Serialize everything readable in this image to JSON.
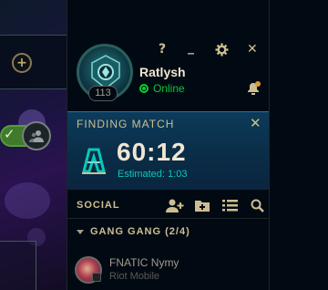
{
  "window_controls": {
    "help": "?",
    "minimize": "_",
    "settings_icon": "gear-icon",
    "close": "✕"
  },
  "profile": {
    "name": "Ratlysh",
    "status": "Online",
    "level": "113",
    "status_color": "#0acb32"
  },
  "finding_match": {
    "title": "FINDING MATCH",
    "timer": "60:12",
    "estimated": "Estimated: 1:03",
    "close": "✕"
  },
  "social": {
    "title": "SOCIAL",
    "icons": [
      "add-friend-icon",
      "add-folder-icon",
      "list-icon",
      "search-icon"
    ]
  },
  "groups": [
    {
      "label": "GANG GANG (2/4)",
      "friends": [
        {
          "name": "FNATIC Nymy",
          "status": "Riot Mobile"
        }
      ]
    }
  ],
  "left_area": {
    "plus": "+"
  },
  "colors": {
    "gold": "#c8aa6e",
    "cyan": "#0ac8b9",
    "panel_bg": "#010a13"
  }
}
